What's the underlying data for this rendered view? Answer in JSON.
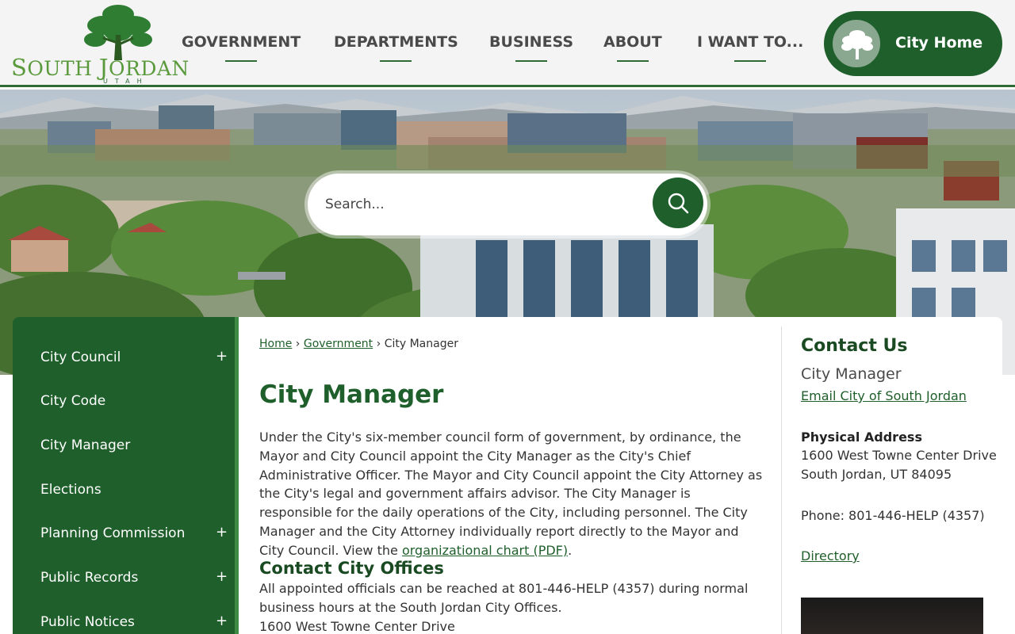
{
  "logo": {
    "name_first": "S",
    "name_rest": "OUTH ",
    "name_j": "J",
    "name_end": "ORDAN",
    "state": "UTAH"
  },
  "nav": {
    "items": [
      {
        "label": "GOVERNMENT"
      },
      {
        "label": "DEPARTMENTS"
      },
      {
        "label": "BUSINESS"
      },
      {
        "label": "ABOUT"
      },
      {
        "label": "I WANT TO..."
      }
    ],
    "city_home_label": "City Home"
  },
  "search": {
    "placeholder": "Search..."
  },
  "sidebar": {
    "items": [
      {
        "label": "City Council",
        "expand": "+"
      },
      {
        "label": "City Code"
      },
      {
        "label": "City Manager"
      },
      {
        "label": "Elections"
      },
      {
        "label": "Planning Commission",
        "expand": "+"
      },
      {
        "label": "Public Records",
        "expand": "+"
      },
      {
        "label": "Public Notices",
        "expand": "+"
      }
    ]
  },
  "breadcrumb": {
    "home": "Home",
    "sep1": "›",
    "government": "Government",
    "sep2": "›",
    "current": "City Manager"
  },
  "main": {
    "title": "City Manager",
    "paragraph": "Under the City's six-member council form of government, by ordinance, the Mayor and City Council appoint the City Manager as the City's Chief Administrative Officer. The Mayor and City Council appoint the City Attorney as the City's legal and government affairs advisor. The City Manager is responsible for the daily operations of the City, including personnel. The City Manager and the City Attorney individually report directly to the Mayor and City Council. View the ",
    "org_chart_link": "organizational chart (PDF)",
    "paragraph_end": ".",
    "offices_heading": "Contact City Offices",
    "offices_text": "All appointed officials can be reached at 801-446-HELP (4357) during normal business hours at the South Jordan City Offices.",
    "offices_address": "1600 West Towne Center Drive"
  },
  "contact": {
    "title": "Contact Us",
    "name": "City Manager",
    "email_link": "Email City of South Jordan",
    "address_label": "Physical Address",
    "address_line1": "1600 West Towne Center Drive",
    "address_line2": "South Jordan, UT 84095",
    "phone": "Phone: 801-446-HELP (4357)",
    "directory_link": "Directory"
  },
  "colors": {
    "brand_green": "#1f5f2b",
    "accent_green": "#3f8a45",
    "logo_green": "#5a9a3c"
  }
}
